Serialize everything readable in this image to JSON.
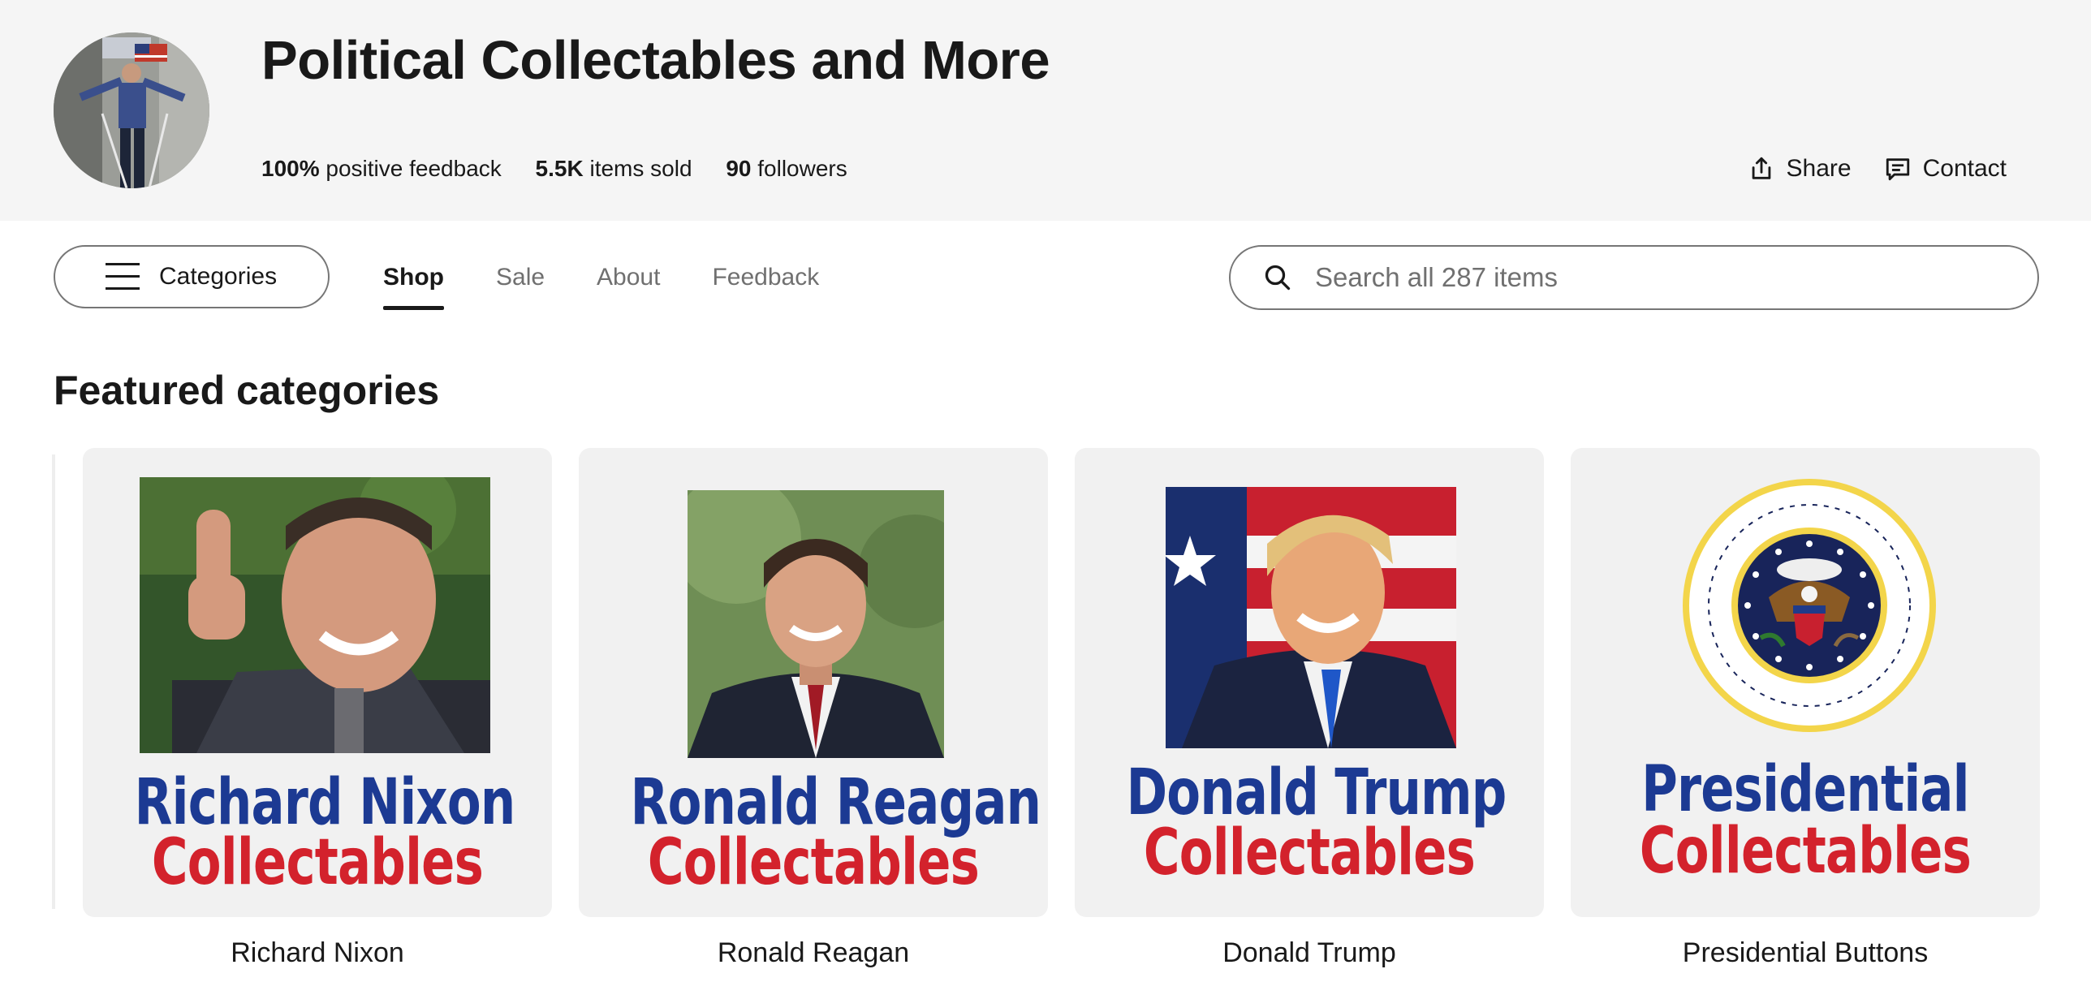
{
  "store": {
    "name": "Political Collectables and More",
    "stats": [
      {
        "value": "100%",
        "label": "positive feedback"
      },
      {
        "value": "5.5K",
        "label": "items sold"
      },
      {
        "value": "90",
        "label": "followers"
      }
    ],
    "actions": {
      "share": "Share",
      "contact": "Contact"
    }
  },
  "nav": {
    "categories_label": "Categories",
    "tabs": [
      "Shop",
      "Sale",
      "About",
      "Feedback"
    ],
    "active_tab": "Shop"
  },
  "search": {
    "placeholder": "Search all 287 items",
    "value": ""
  },
  "featured": {
    "title": "Featured categories",
    "cards": [
      {
        "image_line1": "Richard Nixon",
        "image_line2": "Collectables",
        "name": "Richard Nixon"
      },
      {
        "image_line1": "Ronald Reagan",
        "image_line2": "Collectables",
        "name": "Ronald Reagan"
      },
      {
        "image_line1": "Donald Trump",
        "image_line2": "Collectables",
        "name": "Donald Trump"
      },
      {
        "image_line1": "Presidential",
        "image_line2": "Collectables",
        "name": "Presidential Buttons"
      }
    ]
  },
  "icons": {
    "menu": "hamburger-menu-icon",
    "search": "search-icon",
    "share": "share-icon",
    "contact": "chat-bubble-icon"
  },
  "colors": {
    "header_bg": "#f5f5f5",
    "text": "#191919",
    "muted": "#707070",
    "card_bg": "#f1f1f1",
    "logo_blue": "#1c3a93",
    "logo_red": "#d3222c"
  }
}
